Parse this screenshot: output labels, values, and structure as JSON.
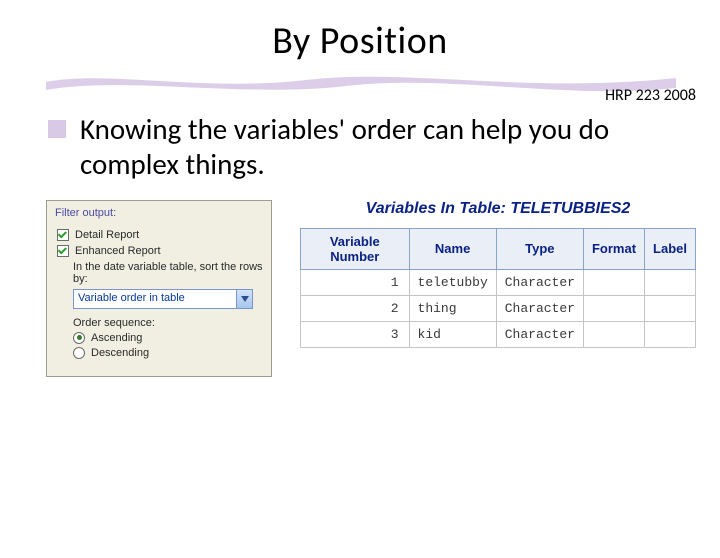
{
  "title": "By Position",
  "course_label": "HRP 223 2008",
  "bullet": "Knowing the variables' order can help you do complex things.",
  "panel": {
    "group_label": "Filter output:",
    "detail_report": "Detail Report",
    "enhanced_report": "Enhanced Report",
    "sort_label": "In the date variable table, sort the rows by:",
    "select_value": "Variable order in table",
    "order_label": "Order sequence:",
    "ascending": "Ascending",
    "descending": "Descending"
  },
  "variables": {
    "heading_prefix": "Variables In Table: ",
    "heading_name": "TELETUBBIES2",
    "columns": {
      "c1": "Variable Number",
      "c2": "Name",
      "c3": "Type",
      "c4": "Format",
      "c5": "Label"
    },
    "rows": [
      {
        "num": "1",
        "name": "teletubby",
        "type": "Character",
        "format": "",
        "label": ""
      },
      {
        "num": "2",
        "name": "thing",
        "type": "Character",
        "format": "",
        "label": ""
      },
      {
        "num": "3",
        "name": "kid",
        "type": "Character",
        "format": "",
        "label": ""
      }
    ]
  }
}
